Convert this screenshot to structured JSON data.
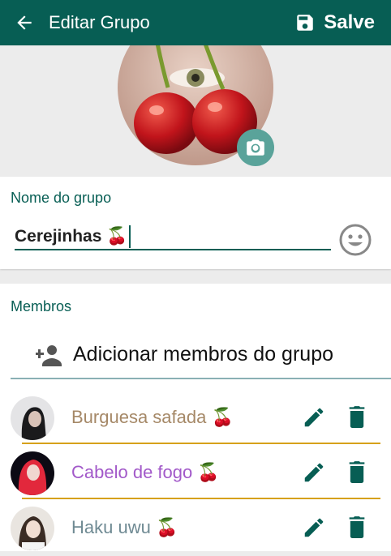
{
  "header": {
    "title": "Editar Grupo",
    "save_label": "Salve",
    "bar_color": "#075e54"
  },
  "group": {
    "name_label": "Nome do grupo",
    "name_value": "Cerejinhas 🍒"
  },
  "members": {
    "section_label": "Membros",
    "add_label": "Adicionar membros do grupo",
    "list": [
      {
        "name": "Burguesa safada 🍒",
        "color": "#a58867"
      },
      {
        "name": "Cabelo de fogo 🍒",
        "color": "#a259c9"
      },
      {
        "name": "Haku uwu 🍒",
        "color": "#6f8a93"
      }
    ]
  },
  "icons": [
    "back-arrow-icon",
    "save-disk-icon",
    "camera-icon",
    "emoji-icon",
    "add-person-icon",
    "pencil-icon",
    "trash-icon"
  ]
}
